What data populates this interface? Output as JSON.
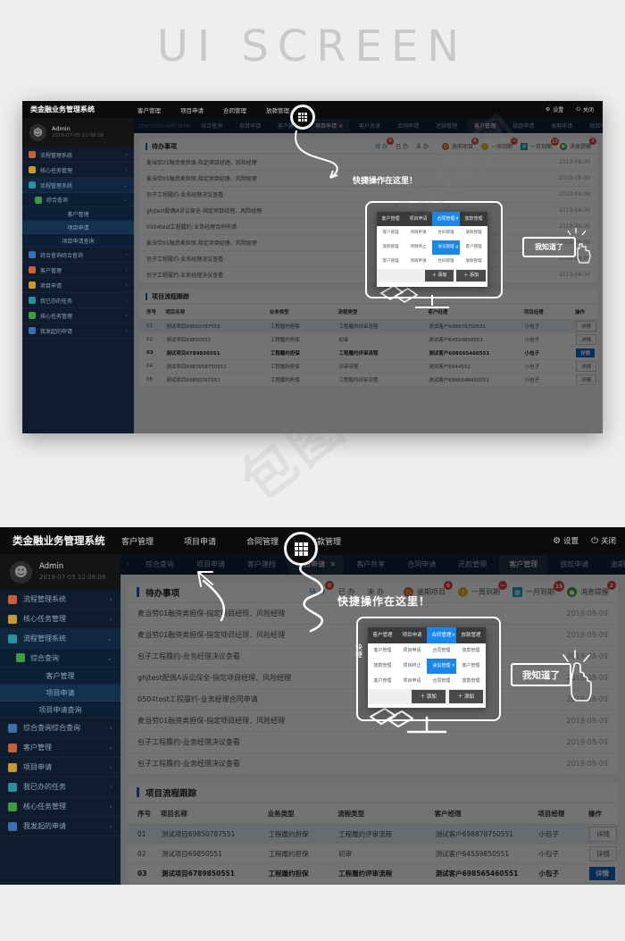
{
  "page": {
    "headline": "UI SCREEN",
    "watermark": "包图网"
  },
  "app": {
    "brand": "类金融业务管理系统",
    "topnav": [
      "客户管理",
      "项目申请",
      "合同管理",
      "放款管理"
    ],
    "grid_icon": "grid-apps-icon",
    "topright": [
      {
        "icon": "gear-icon",
        "label": "设置"
      },
      {
        "icon": "power-icon",
        "label": "关闭"
      }
    ],
    "user": {
      "name": "Admin",
      "time": "2019-07-05 12:08:08",
      "avatar_icon": "user-avatar-icon"
    },
    "sidebar": [
      {
        "label": "流程管理系统",
        "color": "#c4603a",
        "level": 0,
        "arrow": "›"
      },
      {
        "label": "核心任务管理",
        "color": "#c89a2b",
        "level": 0,
        "arrow": "›"
      },
      {
        "label": "流程管理系统",
        "color": "#2a8f9e",
        "level": 0,
        "arrow": "⌄",
        "open": true
      },
      {
        "label": "综合查询",
        "color": "#3f9b3f",
        "level": 1,
        "arrow": "⌄",
        "open": true
      },
      {
        "label": "客户管理",
        "level": 2
      },
      {
        "label": "项目申请",
        "level": 2,
        "active": true
      },
      {
        "label": "项目申请查询",
        "level": 2
      },
      {
        "label": "综合查询综合查询",
        "color": "#3a6fb0",
        "level": 0,
        "arrow": "›"
      },
      {
        "label": "客户管理",
        "color": "#c4603a",
        "level": 0,
        "arrow": "›"
      },
      {
        "label": "项目申请",
        "color": "#c89a2b",
        "level": 0,
        "arrow": "›"
      },
      {
        "label": "我已办的任务",
        "color": "#2a8f9e",
        "level": 0,
        "arrow": "›"
      },
      {
        "label": "核心任务管理",
        "color": "#3f9b3f",
        "level": 0,
        "arrow": "›"
      },
      {
        "label": "我发起的申请",
        "color": "#3a6fb0",
        "level": 0,
        "arrow": "›"
      }
    ],
    "tabs": [
      {
        "label": "综合查询"
      },
      {
        "label": "项目申请"
      },
      {
        "label": "客户建档"
      },
      {
        "label": "项目申请",
        "active": true,
        "close": "✕"
      },
      {
        "label": "客户共享"
      },
      {
        "label": "合同申请"
      },
      {
        "label": "还款管理"
      },
      {
        "label": "客户管理",
        "current": true
      },
      {
        "label": "放款申请"
      },
      {
        "label": "逾期申请"
      },
      {
        "label": "项目申请"
      }
    ],
    "tab_prev_icon": "chevron-left-icon",
    "tab_next_icon": "chevron-right-icon",
    "todo_panel": {
      "title": "待办事项",
      "toggles": [
        {
          "label": "待 办",
          "badge": "0",
          "badge_color": "#e03c3c",
          "active": true
        },
        {
          "label": "已 办"
        },
        {
          "label": "未 办"
        }
      ],
      "stats": [
        {
          "icon": "clock-icon",
          "label": "逾期项目",
          "badge": "6",
          "color": "#e2701e",
          "badge_color": "#e03c3c"
        },
        {
          "icon": "warning-icon",
          "label": "一周到期",
          "badge": "—",
          "color": "#e0b91e",
          "badge_color": "#e03c3c"
        },
        {
          "icon": "calendar-icon",
          "label": "一月到期",
          "badge": "15",
          "color": "#1aa0c8",
          "badge_color": "#e03c3c"
        },
        {
          "icon": "message-icon",
          "label": "消息提醒",
          "badge": "2",
          "color": "#3fa43f",
          "badge_color": "#e03c3c"
        }
      ],
      "items": [
        {
          "text": "麦当劳01融资类担保-指定项目经理、风险经理",
          "date": "2019-08-09"
        },
        {
          "text": "麦当劳01融资类担保-指定项目经理、风险经理",
          "date": "2019-08-09"
        },
        {
          "text": "包子工程履约-业务经理决议查看",
          "date": "2019-08-09"
        },
        {
          "text": "ghjtest配偶A诉讼保全-指定项目经理、风险经理",
          "date": "2019-08-09"
        },
        {
          "text": "0504test工程履约-业务经理合同申请",
          "date": "2019-08-09"
        },
        {
          "text": "麦当劳01融资类担保-指定项目经理、风险经理",
          "date": "2019-08-09"
        },
        {
          "text": "包子工程履约-业务经理决议查看",
          "date": "2019-08-09"
        },
        {
          "text": "包子工程履约-业务经理决议查看",
          "date": "2019-08-09"
        }
      ]
    },
    "table_panel": {
      "title": "项目流程跟踪",
      "columns": [
        "序号",
        "项目名称",
        "业务类型",
        "流程类型",
        "客户经理",
        "项目经理",
        "操作"
      ],
      "rows": [
        {
          "no": "01",
          "name": "测试项目69850787551",
          "biz": "工程履约担保",
          "flow": "工程履约评审流程",
          "cm": "测试客户698878750551",
          "pm": "小包子",
          "action": "详情",
          "selected": true
        },
        {
          "no": "02",
          "name": "测试项目69850551",
          "biz": "工程履约担保",
          "flow": "初审",
          "cm": "测试客户64559850551",
          "pm": "小包子",
          "action": "详情"
        },
        {
          "no": "03",
          "name": "测试项目6789850551",
          "biz": "工程履约担保",
          "flow": "工程履约评审流程",
          "cm": "测试客户698565460551",
          "pm": "小包子",
          "action": "详情",
          "primary": true,
          "bold": true
        },
        {
          "no": "04",
          "name": "测试项目6987658750551",
          "biz": "工程履约担保",
          "flow": "评审流程",
          "cm": "测试客户6944551",
          "pm": "小包子",
          "action": "详情"
        },
        {
          "no": "05",
          "name": "测试项目69850787551",
          "biz": "工程履约担保",
          "flow": "工程履约评审流程",
          "cm": "测试客户6985648450551",
          "pm": "小包子",
          "action": "详情"
        }
      ]
    },
    "guide": {
      "callout": "快捷操作在这里！",
      "confirm": "我知道了",
      "cursor_icon": "hand-cursor-icon",
      "arrow_icon": "curved-arrow-icon",
      "popup": {
        "top_row": [
          {
            "label": "客户管理"
          },
          {
            "label": "项目申请"
          },
          {
            "label": "合同管理",
            "on": true,
            "close": "×"
          },
          {
            "label": "放款管理"
          }
        ],
        "grid": [
          {
            "label": "客户管理"
          },
          {
            "label": "项目申请"
          },
          {
            "label": "合同管理"
          },
          {
            "label": "放款管理"
          },
          {
            "label": "放款管理"
          },
          {
            "label": "项目终止"
          },
          {
            "label": "会议管理",
            "on": true,
            "close": "×"
          },
          {
            "label": "客户管理"
          },
          {
            "label": "客户管理"
          },
          {
            "label": "项目申请"
          },
          {
            "label": "合同管理"
          },
          {
            "label": "放款管理"
          }
        ],
        "buttons": [
          {
            "label": "＋ 添加"
          },
          {
            "label": "＋ 添加"
          }
        ]
      }
    }
  }
}
